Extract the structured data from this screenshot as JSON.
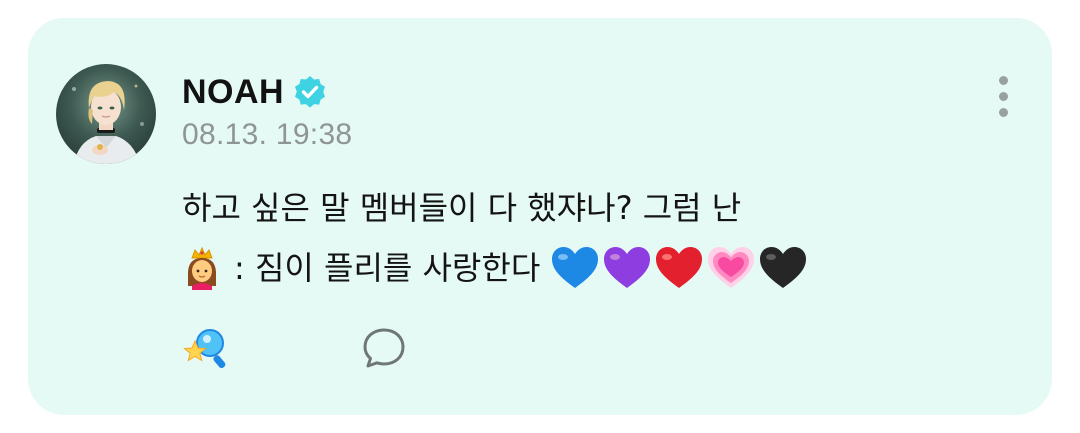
{
  "post": {
    "author": "NOAH",
    "timestamp": "08.13. 19:38",
    "text_line1": "하고 싶은 말 멤버들이 다 했쟈나? 그럼 난",
    "text_line2": ": 짐이 플리를 사랑한다",
    "emojis_line2_leading": "princess-emoji",
    "emojis_line2_trailing": [
      "blue-heart",
      "purple-heart",
      "red-heart",
      "growing-heart",
      "black-heart"
    ]
  },
  "colors": {
    "card_background": "#e6faf5",
    "verified_badge": "#3fd2e3",
    "name": "#121212",
    "timestamp": "#8f9593",
    "more_dots": "#9aa09e",
    "comment_icon": "#6f7775"
  },
  "icons": {
    "verified": "verified-badge-icon",
    "more": "more-vertical-icon",
    "reaction": "star-magnifier-reaction-icon",
    "comment": "speech-bubble-icon"
  }
}
